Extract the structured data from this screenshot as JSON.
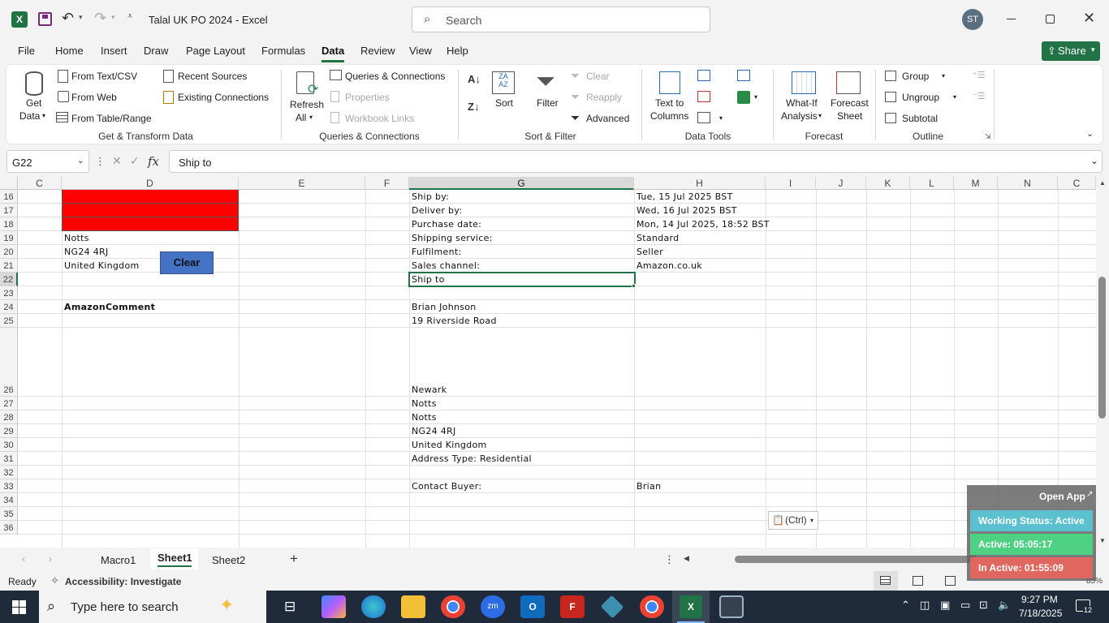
{
  "titlebar": {
    "title": "Talal UK PO 2024  -  Excel",
    "search_placeholder": "Search",
    "user_initials": "ST"
  },
  "tabs": [
    "File",
    "Home",
    "Insert",
    "Draw",
    "Page Layout",
    "Formulas",
    "Data",
    "Review",
    "View",
    "Help"
  ],
  "active_tab": "Data",
  "share_label": "Share",
  "ribbon": {
    "get_data": {
      "l1": "Get",
      "l2": "Data"
    },
    "from_text_csv": "From Text/CSV",
    "from_web": "From Web",
    "from_table_range": "From Table/Range",
    "recent_sources": "Recent Sources",
    "existing_connections": "Existing Connections",
    "group_get_transform": "Get & Transform Data",
    "refresh_all": {
      "l1": "Refresh",
      "l2": "All"
    },
    "queries_connections": "Queries & Connections",
    "properties": "Properties",
    "workbook_links": "Workbook Links",
    "group_queries": "Queries & Connections",
    "sort": "Sort",
    "filter": "Filter",
    "clear": "Clear",
    "reapply": "Reapply",
    "advanced": "Advanced",
    "group_sort_filter": "Sort & Filter",
    "text_to_columns": {
      "l1": "Text to",
      "l2": "Columns"
    },
    "group_data_tools": "Data Tools",
    "what_if": {
      "l1": "What-If",
      "l2": "Analysis"
    },
    "forecast_sheet": {
      "l1": "Forecast",
      "l2": "Sheet"
    },
    "group_forecast": "Forecast",
    "group": "Group",
    "ungroup": "Ungroup",
    "subtotal": "Subtotal",
    "group_outline": "Outline"
  },
  "formula_bar": {
    "name_box": "G22",
    "fx": "fx",
    "content": "Ship to"
  },
  "columns": [
    "C",
    "D",
    "E",
    "F",
    "G",
    "H",
    "I",
    "J",
    "K",
    "L",
    "M",
    "N",
    "C"
  ],
  "rows": [
    "16",
    "17",
    "18",
    "19",
    "20",
    "21",
    "22",
    "23",
    "24",
    "25",
    "26",
    "27",
    "28",
    "29",
    "30",
    "31",
    "32",
    "33",
    "34",
    "35",
    "36"
  ],
  "cells": {
    "D19": "Notts",
    "D20": "NG24 4RJ",
    "D21": "United Kingdom",
    "D24": "AmazonComment",
    "G16": "Ship by:",
    "G17": "Deliver by:",
    "G18": "Purchase date:",
    "G19": "Shipping service:",
    "G20": "Fulfilment:",
    "G21": "Sales channel:",
    "G22": "Ship to",
    "G24": "Brian Johnson",
    "G25": "19 Riverside Road",
    "G26": "Newark",
    "G27": "Notts",
    "G28": "Notts",
    "G29": "NG24 4RJ",
    "G30": "United Kingdom",
    "G31": "Address Type:  Residential",
    "G33": "Contact Buyer:",
    "H16": "Tue, 15 Jul 2025 BST",
    "H17": "Wed, 16 Jul 2025 BST",
    "H18": "Mon, 14 Jul 2025, 18:52 BST",
    "H19": "Standard",
    "H20": "Seller",
    "H21": "Amazon.co.uk",
    "H33": "Brian"
  },
  "clear_button": "Clear",
  "paste_options": "(Ctrl)",
  "sheets": [
    "Macro1",
    "Sheet1",
    "Sheet2"
  ],
  "active_sheet": "Sheet1",
  "status": {
    "ready": "Ready",
    "accessibility": "Accessibility: Investigate",
    "zoom": "85%"
  },
  "widget": {
    "open_app": "Open App",
    "working": "Working Status: Active",
    "active": "Active: 05:05:17",
    "inactive": "In Active: 01:55:09"
  },
  "taskbar": {
    "search_placeholder": "Type here to search",
    "time": "9:27 PM",
    "date": "7/18/2025",
    "notifications": "12"
  },
  "colors": {
    "excel_green": "#217346",
    "red_fill": "#ff0000",
    "clear_btn": "#4472c4",
    "widget_status": "#5bc0d0",
    "widget_active": "#4fd184",
    "widget_inactive": "#e0675f"
  }
}
